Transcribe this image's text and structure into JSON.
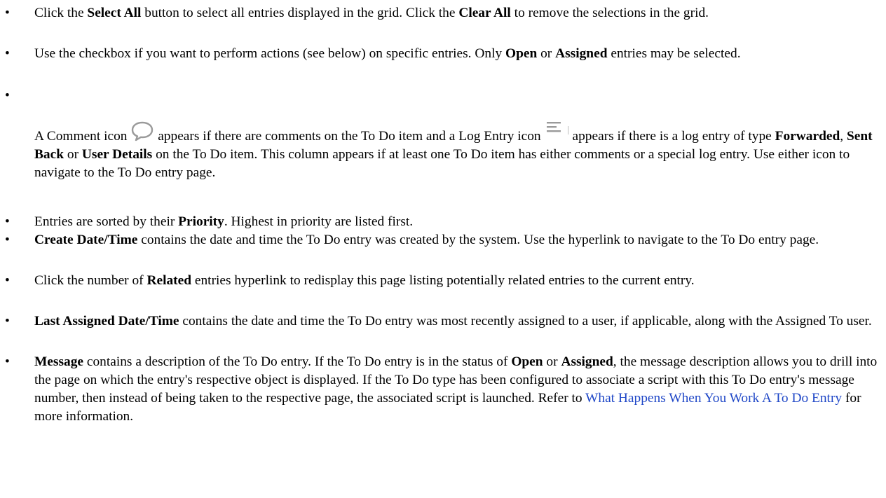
{
  "bullet_char": "•",
  "colors": {
    "link": "#1f47c7",
    "icon": "#9a9a9a"
  },
  "items": [
    {
      "segments": [
        {
          "text": "Click the "
        },
        {
          "text": "Select All",
          "bold": true
        },
        {
          "text": " button to select all entries displayed in the grid. Click the "
        },
        {
          "text": "Clear All",
          "bold": true
        },
        {
          "text": " to remove the selections in the grid."
        }
      ]
    },
    {
      "segments": [
        {
          "text": "Use the checkbox if you want to perform actions (see below) on specific entries. Only "
        },
        {
          "text": "Open",
          "bold": true
        },
        {
          "text": " or "
        },
        {
          "text": "Assigned",
          "bold": true
        },
        {
          "text": " entries may be selected."
        }
      ]
    },
    {
      "segments": []
    },
    {
      "segments": [
        {
          "text": "A Comment icon "
        },
        {
          "icon": "comment-icon"
        },
        {
          "text": " appears if there are comments on the To Do item and a Log Entry icon "
        },
        {
          "icon": "log-entry-icon"
        },
        {
          "text": "appears if there is a log entry of type "
        },
        {
          "text": "Forwarded",
          "bold": true
        },
        {
          "text": ", "
        },
        {
          "text": "Sent Back",
          "bold": true
        },
        {
          "text": " or "
        },
        {
          "text": "User Details",
          "bold": true
        },
        {
          "text": " on the To Do item. This column appears if at least one To Do item has either comments or a special log entry. Use either icon to navigate to the To Do entry page."
        }
      ],
      "no_bullet": true
    },
    {
      "segments": [
        {
          "text": "Entries are sorted by their "
        },
        {
          "text": "Priority",
          "bold": true
        },
        {
          "text": ". Highest in priority are listed first."
        }
      ]
    },
    {
      "segments": [
        {
          "text": "Create Date/Time",
          "bold": true
        },
        {
          "text": " contains the date and time the To Do entry was created by the system. Use the hyperlink to navigate to the To Do entry page."
        }
      ]
    },
    {
      "segments": [
        {
          "text": "Click the number of "
        },
        {
          "text": "Related",
          "bold": true
        },
        {
          "text": " entries hyperlink to redisplay this page listing potentially related entries to the current entry."
        }
      ]
    },
    {
      "segments": [
        {
          "text": "Last Assigned Date/Time",
          "bold": true
        },
        {
          "text": " contains the date and time the To Do entry was most recently assigned to a user, if applicable, along with the Assigned To user."
        }
      ]
    },
    {
      "segments": [
        {
          "text": "Message",
          "bold": true
        },
        {
          "text": " contains a description of the To Do entry. If the To Do entry is in the status of "
        },
        {
          "text": "Open",
          "bold": true
        },
        {
          "text": " or "
        },
        {
          "text": "Assigned",
          "bold": true
        },
        {
          "text": ", the message description allows you to drill into the page on which the entry's respective object is displayed. If the To Do type has been configured to associate a script with this To Do entry's message number, then instead of being taken to the respective page, the associated script is launched. Refer to "
        },
        {
          "text": "What Happens When You Work A To Do Entry",
          "link": true
        },
        {
          "text": " for more information."
        }
      ]
    }
  ]
}
